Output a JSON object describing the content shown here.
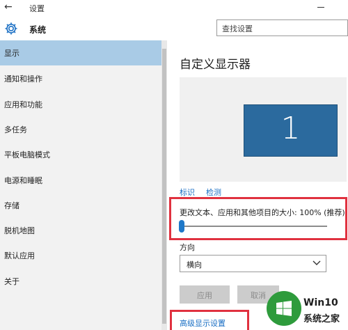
{
  "window": {
    "title": "设置"
  },
  "header": {
    "title": "系统",
    "search_placeholder": "查找设置"
  },
  "sidebar": {
    "items": [
      {
        "label": "显示",
        "active": true
      },
      {
        "label": "通知和操作"
      },
      {
        "label": "应用和功能"
      },
      {
        "label": "多任务"
      },
      {
        "label": "平板电脑模式"
      },
      {
        "label": "电源和睡眠"
      },
      {
        "label": "存储"
      },
      {
        "label": "脱机地图"
      },
      {
        "label": "默认应用"
      },
      {
        "label": "关于"
      }
    ]
  },
  "main": {
    "title": "自定义显示器",
    "monitor_number": "1",
    "identify_link": "标识",
    "detect_link": "检测",
    "scale_label": "更改文本、应用和其他项目的大小: 100% (推荐)",
    "scale_slider_value": 0,
    "orientation_label": "方向",
    "orientation_value": "横向",
    "apply_button": "应用",
    "cancel_button": "取消",
    "advanced_link": "高级显示设置"
  },
  "watermark": {
    "line1": "Win10",
    "line2": "系统之家"
  },
  "colors": {
    "accent": "#1a6fc4",
    "sidebar_active": "#a9cbe6",
    "highlight_box": "#e0313f",
    "monitor": "#2b6a9e"
  }
}
